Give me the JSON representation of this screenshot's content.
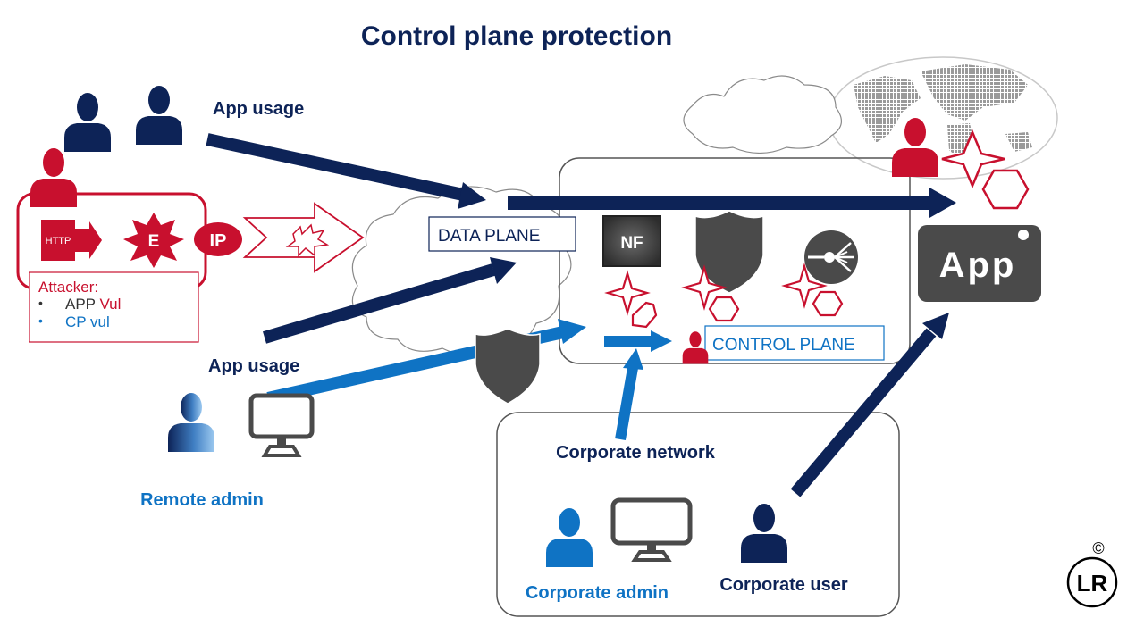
{
  "title": "Control plane protection",
  "colors": {
    "navy": "#0d2357",
    "crimson": "#c8102e",
    "blue": "#0f73c4",
    "gray": "#4a4a4a"
  },
  "labels": {
    "app_usage_top": "App usage",
    "app_usage_bottom": "App usage",
    "data_plane": "DATA PLANE",
    "control_plane": "CONTROL PLANE",
    "corporate_network": "Corporate network",
    "remote_admin": "Remote admin",
    "corporate_admin": "Corporate  admin",
    "corporate_user": "Corporate user",
    "app_tile": "App",
    "nf": "NF",
    "http": "HTTP",
    "exploit": "E",
    "ip": "IP",
    "copyright": "©",
    "logo": "LR"
  },
  "attacker_box": {
    "heading": "Attacker:",
    "items": [
      {
        "bullet": "•",
        "text_a": "APP ",
        "text_b": "Vul"
      },
      {
        "bullet": "•",
        "text_a": "CP vul",
        "text_b": ""
      }
    ]
  },
  "icons": [
    "person-icon",
    "monitor-icon",
    "shield-icon",
    "router-icon",
    "cloud-icon",
    "globe-icon",
    "vulnerability-star-icon",
    "vulnerability-hexagon-icon",
    "explosion-icon",
    "http-arrow-icon",
    "lr-logo-icon"
  ]
}
